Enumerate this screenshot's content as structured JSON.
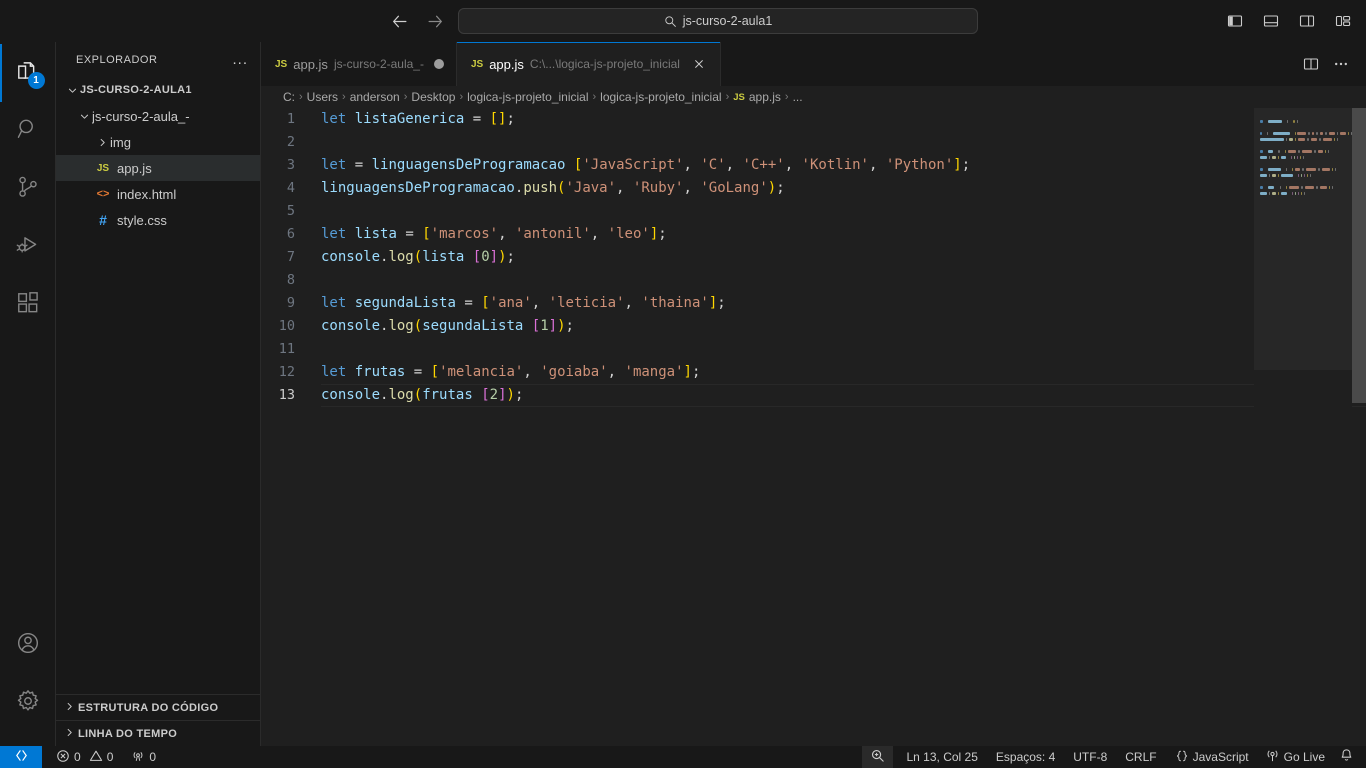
{
  "titlebar": {
    "back_icon": "arrow-left-icon",
    "forward_icon": "arrow-right-icon",
    "search_value": "js-curso-2-aula1",
    "search_icon": "search-icon",
    "layout_buttons": [
      {
        "name": "toggle-primary-sidebar-icon"
      },
      {
        "name": "toggle-panel-icon"
      },
      {
        "name": "toggle-secondary-sidebar-icon"
      },
      {
        "name": "customize-layout-icon"
      }
    ]
  },
  "activitybar": {
    "items": [
      {
        "name": "explorer",
        "icon": "files-icon",
        "badge": "1",
        "active": true
      },
      {
        "name": "search",
        "icon": "search-icon",
        "badge": "",
        "active": false
      },
      {
        "name": "source-control",
        "icon": "source-control-icon",
        "badge": "",
        "active": false
      },
      {
        "name": "run-and-debug",
        "icon": "debug-icon",
        "badge": "",
        "active": false
      },
      {
        "name": "extensions",
        "icon": "extensions-icon",
        "badge": "",
        "active": false
      }
    ],
    "bottom": [
      {
        "name": "accounts",
        "icon": "account-icon"
      },
      {
        "name": "manage",
        "icon": "gear-icon"
      }
    ]
  },
  "sidebar": {
    "title": "EXPLORADOR",
    "more_actions": "...",
    "tree": [
      {
        "label": "JS-CURSO-2-AULA1",
        "level": 0,
        "kind": "root",
        "expanded": true,
        "selected": false
      },
      {
        "label": "js-curso-2-aula_-",
        "level": 1,
        "kind": "folder",
        "expanded": true,
        "selected": false
      },
      {
        "label": "img",
        "level": 2,
        "kind": "folder",
        "expanded": false,
        "selected": false
      },
      {
        "label": "app.js",
        "level": 2,
        "kind": "js",
        "expanded": null,
        "selected": true
      },
      {
        "label": "index.html",
        "level": 2,
        "kind": "html",
        "expanded": null,
        "selected": false
      },
      {
        "label": "style.css",
        "level": 2,
        "kind": "css",
        "expanded": null,
        "selected": false
      }
    ],
    "sections": [
      {
        "label": "ESTRUTURA DO CÓDIGO",
        "expanded": false
      },
      {
        "label": "LINHA DO TEMPO",
        "expanded": false
      }
    ]
  },
  "editor": {
    "tabs": [
      {
        "name": "app.js",
        "description": "js-curso-2-aula_-",
        "active": false,
        "dirty": true,
        "closable": false
      },
      {
        "name": "app.js",
        "description": "C:\\...\\logica-js-projeto_inicial",
        "active": true,
        "dirty": false,
        "closable": true
      }
    ],
    "tab_actions": [
      {
        "name": "split-editor-icon"
      },
      {
        "name": "more-actions-icon"
      }
    ],
    "breadcrumbs": [
      "C:",
      "Users",
      "anderson",
      "Desktop",
      "logica-js-projeto_inicial",
      "logica-js-projeto_inicial",
      "app.js",
      "..."
    ],
    "breadcrumb_file_index": 6,
    "lines": [
      {
        "n": 1,
        "tokens": [
          {
            "t": "let",
            "c": "kw"
          },
          {
            "t": " ",
            "c": "op"
          },
          {
            "t": "listaGenerica",
            "c": "id"
          },
          {
            "t": " ",
            "c": "op"
          },
          {
            "t": "=",
            "c": "op"
          },
          {
            "t": " ",
            "c": "op"
          },
          {
            "t": "[]",
            "c": "brk1"
          },
          {
            "t": ";",
            "c": "pun"
          }
        ]
      },
      {
        "n": 2,
        "tokens": []
      },
      {
        "n": 3,
        "tokens": [
          {
            "t": "let",
            "c": "kw"
          },
          {
            "t": " ",
            "c": "op"
          },
          {
            "t": "=",
            "c": "op"
          },
          {
            "t": " ",
            "c": "op"
          },
          {
            "t": "linguagensDeProgramacao",
            "c": "id"
          },
          {
            "t": " ",
            "c": "op"
          },
          {
            "t": "[",
            "c": "brk1"
          },
          {
            "t": "'JavaScript'",
            "c": "str"
          },
          {
            "t": ", ",
            "c": "pun"
          },
          {
            "t": "'C'",
            "c": "str"
          },
          {
            "t": ", ",
            "c": "pun"
          },
          {
            "t": "'C++'",
            "c": "str"
          },
          {
            "t": ", ",
            "c": "pun"
          },
          {
            "t": "'Kotlin'",
            "c": "str"
          },
          {
            "t": ", ",
            "c": "pun"
          },
          {
            "t": "'Python'",
            "c": "str"
          },
          {
            "t": "]",
            "c": "brk1"
          },
          {
            "t": ";",
            "c": "pun"
          }
        ]
      },
      {
        "n": 4,
        "tokens": [
          {
            "t": "linguagensDeProgramacao",
            "c": "id"
          },
          {
            "t": ".",
            "c": "pun"
          },
          {
            "t": "push",
            "c": "fn"
          },
          {
            "t": "(",
            "c": "brk1"
          },
          {
            "t": "'Java'",
            "c": "str"
          },
          {
            "t": ", ",
            "c": "pun"
          },
          {
            "t": "'Ruby'",
            "c": "str"
          },
          {
            "t": ", ",
            "c": "pun"
          },
          {
            "t": "'GoLang'",
            "c": "str"
          },
          {
            "t": ")",
            "c": "brk1"
          },
          {
            "t": ";",
            "c": "pun"
          }
        ]
      },
      {
        "n": 5,
        "tokens": []
      },
      {
        "n": 6,
        "tokens": [
          {
            "t": "let",
            "c": "kw"
          },
          {
            "t": " ",
            "c": "op"
          },
          {
            "t": "lista",
            "c": "id"
          },
          {
            "t": " ",
            "c": "op"
          },
          {
            "t": "=",
            "c": "op"
          },
          {
            "t": " ",
            "c": "op"
          },
          {
            "t": "[",
            "c": "brk1"
          },
          {
            "t": "'marcos'",
            "c": "str"
          },
          {
            "t": ", ",
            "c": "pun"
          },
          {
            "t": "'antonil'",
            "c": "str"
          },
          {
            "t": ", ",
            "c": "pun"
          },
          {
            "t": "'leo'",
            "c": "str"
          },
          {
            "t": "]",
            "c": "brk1"
          },
          {
            "t": ";",
            "c": "pun"
          }
        ]
      },
      {
        "n": 7,
        "tokens": [
          {
            "t": "console",
            "c": "id"
          },
          {
            "t": ".",
            "c": "pun"
          },
          {
            "t": "log",
            "c": "fn"
          },
          {
            "t": "(",
            "c": "brk1"
          },
          {
            "t": "lista",
            "c": "id"
          },
          {
            "t": " ",
            "c": "op"
          },
          {
            "t": "[",
            "c": "brk2"
          },
          {
            "t": "0",
            "c": "num"
          },
          {
            "t": "]",
            "c": "brk2"
          },
          {
            "t": ")",
            "c": "brk1"
          },
          {
            "t": ";",
            "c": "pun"
          }
        ]
      },
      {
        "n": 8,
        "tokens": []
      },
      {
        "n": 9,
        "tokens": [
          {
            "t": "let",
            "c": "kw"
          },
          {
            "t": " ",
            "c": "op"
          },
          {
            "t": "segundaLista",
            "c": "id"
          },
          {
            "t": " ",
            "c": "op"
          },
          {
            "t": "=",
            "c": "op"
          },
          {
            "t": " ",
            "c": "op"
          },
          {
            "t": "[",
            "c": "brk1"
          },
          {
            "t": "'ana'",
            "c": "str"
          },
          {
            "t": ", ",
            "c": "pun"
          },
          {
            "t": "'leticia'",
            "c": "str"
          },
          {
            "t": ", ",
            "c": "pun"
          },
          {
            "t": "'thaina'",
            "c": "str"
          },
          {
            "t": "]",
            "c": "brk1"
          },
          {
            "t": ";",
            "c": "pun"
          }
        ]
      },
      {
        "n": 10,
        "tokens": [
          {
            "t": "console",
            "c": "id"
          },
          {
            "t": ".",
            "c": "pun"
          },
          {
            "t": "log",
            "c": "fn"
          },
          {
            "t": "(",
            "c": "brk1"
          },
          {
            "t": "segundaLista",
            "c": "id"
          },
          {
            "t": " ",
            "c": "op"
          },
          {
            "t": "[",
            "c": "brk2"
          },
          {
            "t": "1",
            "c": "num"
          },
          {
            "t": "]",
            "c": "brk2"
          },
          {
            "t": ")",
            "c": "brk1"
          },
          {
            "t": ";",
            "c": "pun"
          }
        ]
      },
      {
        "n": 11,
        "tokens": []
      },
      {
        "n": 12,
        "tokens": [
          {
            "t": "let",
            "c": "kw"
          },
          {
            "t": " ",
            "c": "op"
          },
          {
            "t": "frutas",
            "c": "id"
          },
          {
            "t": " ",
            "c": "op"
          },
          {
            "t": "=",
            "c": "op"
          },
          {
            "t": " ",
            "c": "op"
          },
          {
            "t": "[",
            "c": "brk1"
          },
          {
            "t": "'melancia'",
            "c": "str"
          },
          {
            "t": ", ",
            "c": "pun"
          },
          {
            "t": "'goiaba'",
            "c": "str"
          },
          {
            "t": ", ",
            "c": "pun"
          },
          {
            "t": "'manga'",
            "c": "str"
          },
          {
            "t": "]",
            "c": "brk1"
          },
          {
            "t": ";",
            "c": "pun"
          }
        ]
      },
      {
        "n": 13,
        "current": true,
        "tokens": [
          {
            "t": "console",
            "c": "id"
          },
          {
            "t": ".",
            "c": "pun"
          },
          {
            "t": "log",
            "c": "fn"
          },
          {
            "t": "(",
            "c": "brk1"
          },
          {
            "t": "frutas",
            "c": "id"
          },
          {
            "t": " ",
            "c": "op"
          },
          {
            "t": "[",
            "c": "brk2"
          },
          {
            "t": "2",
            "c": "num"
          },
          {
            "t": "]",
            "c": "brk2"
          },
          {
            "t": ")",
            "c": "brk1"
          },
          {
            "t": ";",
            "c": "pun"
          }
        ]
      }
    ]
  },
  "statusbar": {
    "remote_icon": "remote-window-icon",
    "problems": {
      "errors_icon": "error-icon",
      "errors": "0",
      "warnings_icon": "warning-icon",
      "warnings": "0"
    },
    "ports": {
      "icon": "radio-tower-icon",
      "count": "0"
    },
    "zoom_icon": "screencast-zoom-icon",
    "cursor_position": "Ln 13, Col 25",
    "indentation": "Espaços: 4",
    "encoding": "UTF-8",
    "eol": "CRLF",
    "language_icon": "braces-icon",
    "language": "JavaScript",
    "golive_icon": "broadcast-icon",
    "golive": "Go Live",
    "notifications_icon": "bell-icon"
  },
  "colors": {
    "accent": "#0078d4",
    "titlebar_bg": "#181818",
    "editor_bg": "#1f1f1f",
    "sidebar_bg": "#181818",
    "selection_bg": "#2a2d2e"
  }
}
